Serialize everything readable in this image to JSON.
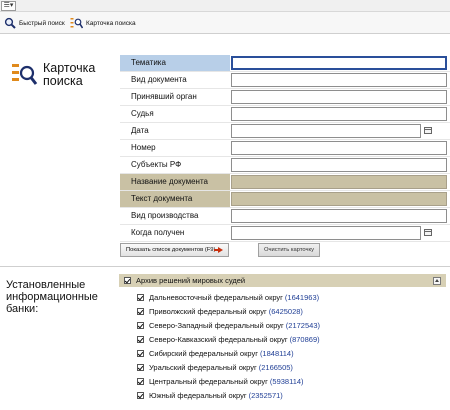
{
  "menubar": {
    "menu_icon": "hamburger-menu-icon"
  },
  "toolbar": {
    "quick_search": {
      "label": "Быстрый поиск",
      "icon": "magnifier-icon"
    },
    "search_card": {
      "label": "Карточка поиска",
      "icon": "search-card-icon"
    }
  },
  "card": {
    "title": "Карточка поиска",
    "icon": "search-card-large-icon"
  },
  "form": {
    "fields": [
      {
        "label": "Тематика",
        "value": ""
      },
      {
        "label": "Вид документа",
        "value": ""
      },
      {
        "label": "Принявший орган",
        "value": ""
      },
      {
        "label": "Судья",
        "value": ""
      },
      {
        "label": "Дата",
        "value": ""
      },
      {
        "label": "Номер",
        "value": ""
      },
      {
        "label": "Субъекты РФ",
        "value": ""
      },
      {
        "label": "Название документа",
        "value": ""
      },
      {
        "label": "Текст документа",
        "value": ""
      },
      {
        "label": "Вид производства",
        "value": ""
      },
      {
        "label": "Когда получен",
        "value": ""
      }
    ],
    "show_button": "Показать список документов (F9)",
    "clear_button": "Очистить карточку"
  },
  "banks": {
    "title": "Установленные информационные банки:",
    "group": {
      "label": "Архив решений мировых судей",
      "checked": true
    },
    "items": [
      {
        "name": "Дальневосточный федеральный округ",
        "count": "(1641963)",
        "checked": true
      },
      {
        "name": "Приволжский федеральный округ",
        "count": "(6425028)",
        "checked": true
      },
      {
        "name": "Северо-Западный федеральный округ",
        "count": "(2172543)",
        "checked": true
      },
      {
        "name": "Северо-Кавказский федеральный округ",
        "count": "(870869)",
        "checked": true
      },
      {
        "name": "Сибирский федеральный округ",
        "count": "(1848114)",
        "checked": true
      },
      {
        "name": "Уральский федеральный округ",
        "count": "(2166505)",
        "checked": true
      },
      {
        "name": "Центральный федеральный округ",
        "count": "(5938114)",
        "checked": true
      },
      {
        "name": "Южный федеральный округ",
        "count": "(2352571)",
        "checked": true
      }
    ]
  },
  "colors": {
    "active_field_border": "#2a4f9a",
    "highlight_blue": "#b8cfe8",
    "highlight_grey": "#c9c1a4",
    "count_link": "#1f3e95",
    "arrow_red": "#c8300f"
  }
}
